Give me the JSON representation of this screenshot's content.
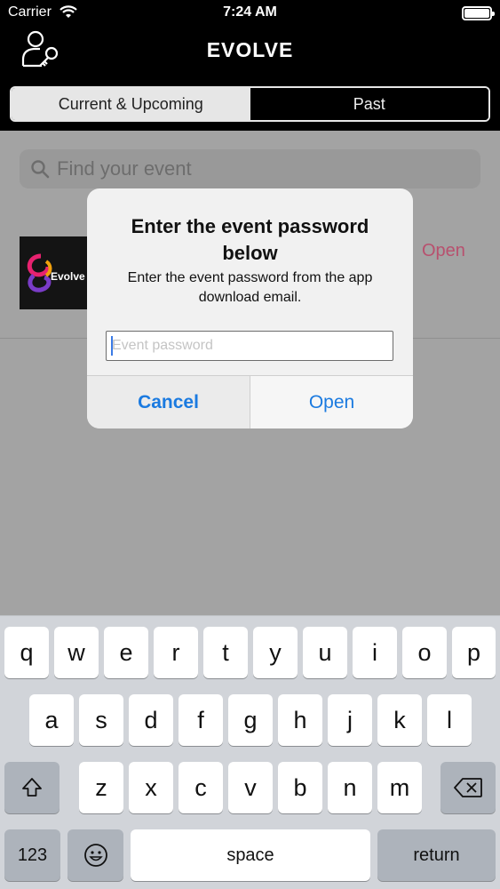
{
  "status_bar": {
    "carrier": "Carrier",
    "time": "7:24 AM"
  },
  "header": {
    "title": "EVOLVE",
    "icon": "user-key-icon"
  },
  "tabs": [
    {
      "label": "Current & Upcoming",
      "selected": true
    },
    {
      "label": "Past",
      "selected": false
    }
  ],
  "search": {
    "placeholder": "Find your event"
  },
  "event": {
    "logo_text": "Evolve",
    "open_label": "Open"
  },
  "alert": {
    "title": "Enter the event password below",
    "message": "Enter the event password from the app download email.",
    "input_placeholder": "Event password",
    "input_value": "",
    "cancel_label": "Cancel",
    "open_label": "Open"
  },
  "keyboard": {
    "row1": [
      "q",
      "w",
      "e",
      "r",
      "t",
      "y",
      "u",
      "i",
      "o",
      "p"
    ],
    "row2": [
      "a",
      "s",
      "d",
      "f",
      "g",
      "h",
      "j",
      "k",
      "l"
    ],
    "row3": [
      "z",
      "x",
      "c",
      "v",
      "b",
      "n",
      "m"
    ],
    "numbers_label": "123",
    "space_label": "space",
    "return_label": "return"
  },
  "colors": {
    "accent_blue": "#1a7ae0",
    "open_pink": "#b8506e",
    "header_bg": "#000000",
    "dim_bg": "#a3a3a3"
  }
}
